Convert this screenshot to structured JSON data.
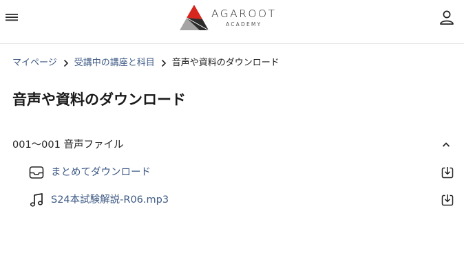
{
  "header": {
    "menu_icon": "hamburger-menu-icon",
    "logo": {
      "wordmark": "AGAROOT",
      "subtitle": "ACADEMY",
      "colors": {
        "red": "#d7261e",
        "dark": "#2b2b2b",
        "gray": "#9a9a9a"
      }
    },
    "user_icon": "user-account-icon"
  },
  "breadcrumb": {
    "items": [
      {
        "label": "マイページ"
      },
      {
        "label": "受講中の講座と科目"
      }
    ],
    "current": "音声や資料のダウンロード"
  },
  "page": {
    "title": "音声や資料のダウンロード"
  },
  "section": {
    "title": "001〜001 音声ファイル",
    "expanded": true,
    "files": [
      {
        "label": "まとめてダウンロード",
        "icon": "inbox-tray-icon"
      },
      {
        "label": "S24本試験解説-R06.mp3",
        "icon": "music-note-icon"
      }
    ]
  },
  "colors": {
    "link": "#3e5a86",
    "text": "#1f1f1f",
    "divider": "#e3e3e3"
  }
}
